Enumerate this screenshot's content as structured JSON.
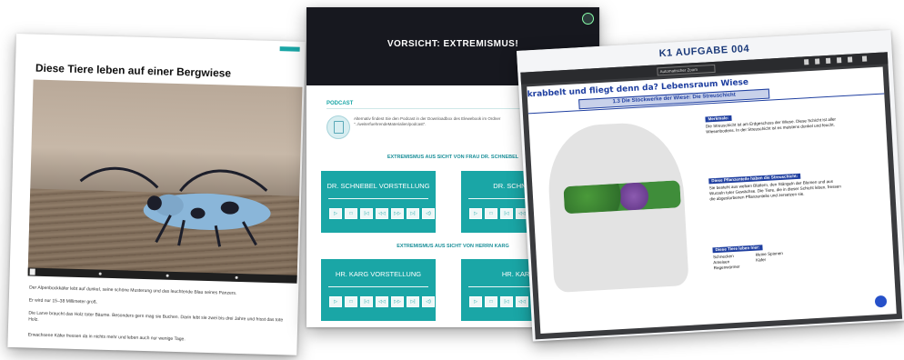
{
  "left": {
    "title": "Diese Tiere leben auf einer Bergwiese",
    "p1": "Der Alpenbockkäfer lebt auf dunkel, seine schöne Musterung und das leuchtende Blau seines Panzers.",
    "p2": "Er wird nur 15–38 Millimeter groß.",
    "p3": "Die Larve braucht das Holz toter Bäume. Besonders gern mag sie Buchen. Darin lebt sie zwei bis drei Jahre und frisst das tote Holz.",
    "p4": "Erwachsene Käfer fressen da in nichts mehr und leben auch nur wenige Tage."
  },
  "middle": {
    "header_title": "VORSICHT: EXTREMISMUS!",
    "podcast_label": "PODCAST",
    "podcast_text": "Alternativ findest Sie den Podcast in der Downloadbox des Elewebook im Ordner \"../weiterfuehrendeMaterialien/podcast\".",
    "section1": "EXTREMISMUS AUS SICHT VON FRAU DR. SCHNEBEL",
    "section2": "EXTREMISMUS AUS SICHT VON HERRN KARG",
    "boxes": [
      {
        "title": "DR. SCHNEBEL VORSTELLUNG"
      },
      {
        "title": "DR. SCHNEBEL"
      },
      {
        "title": "HR. KARG VORSTELLUNG"
      },
      {
        "title": "HR. KARG"
      }
    ],
    "controls": [
      "▷",
      "□",
      "|◁",
      "◁◁",
      "▷▷",
      "▷|",
      "◁)"
    ],
    "controls_short": [
      "▷",
      "□",
      "|◁",
      "◁◁",
      "▷▷",
      "◁)"
    ]
  },
  "right": {
    "title": "K1 AUFGABE 004",
    "zoom": "Automatischer Zoom",
    "page_title": "krabbelt und fliegt denn da? Lebensraum Wiese",
    "page_subtitle": "1.3 Die Stockwerke der Wiese: Die Streuschicht",
    "box1_head": "Merkmale:",
    "box1_text": "Die Streuschicht ist am Erdgeschoss der Wiese. Diese Schicht ist aller Wiesenbodens. In der Streuschicht ist es meistens dunkel und feucht.",
    "box2_head": "Diese Pflanzenteile haben die Streuschicht:",
    "box2_text": "Sie besteht aus welken Blättern, den Stängeln der Blumen und aus Wurzeln toter Gewächse. Die Tiere, die in dieser Schicht leben, fressen die abgestorbenen Pflanzenteile und zersetzen sie.",
    "box3_head": "Diese Tiere leben hier:",
    "animals_col1": [
      "Schnecken",
      "Ameisen",
      "Regenwürmer"
    ],
    "animals_col2": [
      "kleine Spinnen",
      "Käfer"
    ]
  }
}
